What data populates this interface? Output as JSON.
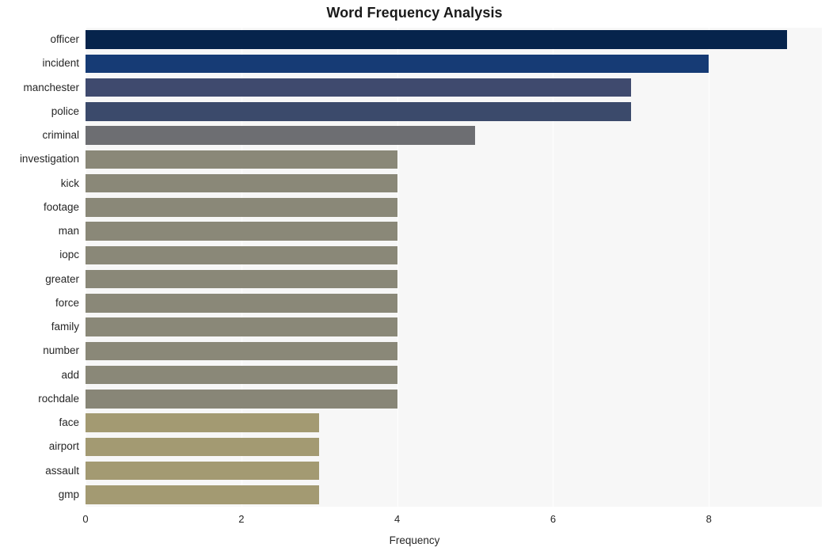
{
  "chart_data": {
    "type": "bar",
    "orientation": "horizontal",
    "title": "Word Frequency Analysis",
    "xlabel": "Frequency",
    "ylabel": "",
    "xlim": [
      0,
      9.45
    ],
    "xticks": [
      0,
      2,
      4,
      6,
      8
    ],
    "grid": true,
    "legend": null,
    "categories": [
      "officer",
      "incident",
      "manchester",
      "police",
      "criminal",
      "investigation",
      "kick",
      "footage",
      "man",
      "iopc",
      "greater",
      "force",
      "family",
      "number",
      "add",
      "rochdale",
      "face",
      "airport",
      "assault",
      "gmp"
    ],
    "values": [
      9,
      8,
      7,
      7,
      5,
      4,
      4,
      4,
      4,
      4,
      4,
      4,
      4,
      4,
      4,
      4,
      3,
      3,
      3,
      3
    ],
    "bar_colors": [
      "#06244c",
      "#163b75",
      "#3f4a6e",
      "#3b4a6b",
      "#6d6e72",
      "#8a8878",
      "#8a8878",
      "#8a8878",
      "#8a8878",
      "#8a8878",
      "#8a8878",
      "#8a8878",
      "#8a8878",
      "#8a8878",
      "#8a8878",
      "#888677",
      "#a39a72",
      "#a39a72",
      "#a39a72",
      "#a39a72"
    ],
    "plot_background": "#f7f7f7",
    "gridline_color": "#ffffff",
    "figure_background": "#ffffff"
  }
}
